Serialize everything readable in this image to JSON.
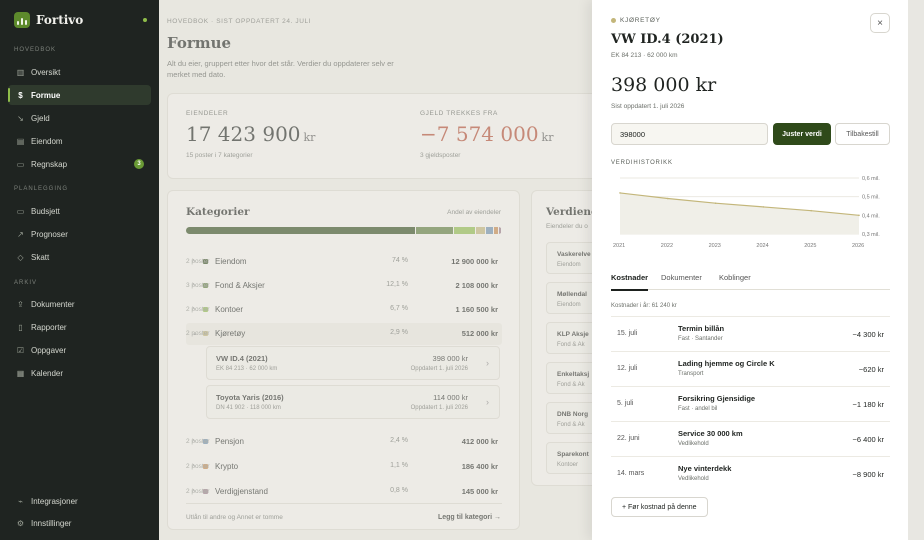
{
  "app": {
    "name": "Fortivo"
  },
  "sidebar": {
    "sections": {
      "main": "HOVEDBOK",
      "planning": "PLANLEGGING",
      "archive": "ARKIV"
    },
    "items": [
      {
        "label": "Oversikt",
        "icon": "bar-chart-icon"
      },
      {
        "label": "Formue",
        "icon": "dollar-icon",
        "active": true
      },
      {
        "label": "Gjeld",
        "icon": "trend-down-icon"
      },
      {
        "label": "Eiendom",
        "icon": "building-icon"
      },
      {
        "label": "Regnskap",
        "icon": "wallet-icon",
        "badge": "3"
      },
      {
        "label": "Budsjett",
        "icon": "card-icon"
      },
      {
        "label": "Prognoser",
        "icon": "trend-up-icon"
      },
      {
        "label": "Skatt",
        "icon": "shield-icon"
      },
      {
        "label": "Dokumenter",
        "icon": "upload-icon"
      },
      {
        "label": "Rapporter",
        "icon": "document-icon"
      },
      {
        "label": "Oppgaver",
        "icon": "checkbox-icon"
      },
      {
        "label": "Kalender",
        "icon": "calendar-icon"
      }
    ],
    "footer": [
      {
        "label": "Integrasjoner",
        "icon": "plug-icon"
      },
      {
        "label": "Innstillinger",
        "icon": "gear-icon"
      }
    ]
  },
  "main": {
    "breadcrumb": "HOVEDBOK · SIST OPPDATERT 24. JULI",
    "title": "Formue",
    "description": "Alt du eier, gruppert etter hvor det står. Verdier du oppdaterer selv er merket med dato.",
    "assets": {
      "label": "EIENDELER",
      "value": "17 423 900",
      "unit": "kr",
      "sub": "15 poster i 7 kategorier"
    },
    "debt": {
      "label": "GJELD TREKKES FRA",
      "value": "−7 574 000",
      "unit": "kr",
      "sub": "3 gjeldsposter"
    },
    "categories": {
      "title": "Kategorier",
      "share_label": "Andel av eiendeler",
      "rows": [
        {
          "name": "Eiendom",
          "count": "2 poster",
          "pct": "74 %",
          "amount": "12 900 000 kr",
          "color": "#2f4a1a",
          "chevron": "›"
        },
        {
          "name": "Fond & Aksjer",
          "count": "3 poster",
          "pct": "12,1 %",
          "amount": "2 108 000 kr",
          "color": "#5a7a3a",
          "chevron": "›"
        },
        {
          "name": "Kontoer",
          "count": "2 poster",
          "pct": "6,7 %",
          "amount": "1 160 500 kr",
          "color": "#8fbd4a",
          "chevron": "›"
        },
        {
          "name": "Kjøretøy",
          "count": "2 poster",
          "pct": "2,9 %",
          "amount": "512 000 kr",
          "color": "#c3b67a",
          "chevron": "⌄"
        },
        {
          "name": "Pensjon",
          "count": "2 poster",
          "pct": "2,4 %",
          "amount": "412 000 kr",
          "color": "#6c8fb0",
          "chevron": "›"
        },
        {
          "name": "Krypto",
          "count": "2 poster",
          "pct": "1,1 %",
          "amount": "186 400 kr",
          "color": "#c9884a",
          "chevron": "›"
        },
        {
          "name": "Verdigjenstand",
          "count": "2 poster",
          "pct": "0,8 %",
          "amount": "145 000 kr",
          "color": "#9a7a8a",
          "chevron": "›"
        }
      ],
      "vehicles": [
        {
          "title": "VW ID.4 (2021)",
          "sub": "EK 84 213 · 62 000 km",
          "amount": "398 000 kr",
          "date": "Oppdatert 1. juli 2026"
        },
        {
          "title": "Toyota Yaris (2016)",
          "sub": "DN 41 902 · 118 000 km",
          "amount": "114 000 kr",
          "date": "Oppdatert 1. juli 2026"
        }
      ],
      "footer_note": "Utlån til andre og Annet er tomme",
      "add_category": "Legg til kategori →"
    },
    "values_card": {
      "title": "Verdiene d",
      "sub": "Eiendeler du o",
      "items": [
        {
          "title": "Vaskerelve",
          "sub": "Eiendom"
        },
        {
          "title": "Møllendal",
          "sub": "Eiendom"
        },
        {
          "title": "KLP Aksje",
          "sub": "Fond & Ak"
        },
        {
          "title": "Enkeltaksj",
          "sub": "Fond & Ak"
        },
        {
          "title": "DNB Norg",
          "sub": "Fond & Ak"
        },
        {
          "title": "Sparekont",
          "sub": "Kontoer"
        }
      ]
    }
  },
  "drawer": {
    "kicker": "KJØRETØY",
    "title": "VW ID.4 (2021)",
    "sub": "EK 84 213 · 62 000 km",
    "value": "398 000 kr",
    "updated": "Sist oppdatert 1. juli 2026",
    "input_value": "398000",
    "adjust_label": "Juster verdi",
    "reset_label": "Tilbakestill",
    "history_label": "VERDIHISTORIKK",
    "tabs": [
      "Kostnader",
      "Dokumenter",
      "Koblinger"
    ],
    "cost_summary": "Kostnader i år: 61 240 kr",
    "costs": [
      {
        "date": "15. juli",
        "title": "Termin billån",
        "category": "Fast · Santander",
        "amount": "−4 300 kr"
      },
      {
        "date": "12. juli",
        "title": "Lading hjemme og Circle K",
        "category": "Transport",
        "amount": "−620 kr"
      },
      {
        "date": "5. juli",
        "title": "Forsikring Gjensidige",
        "category": "Fast · andel bil",
        "amount": "−1 180 kr"
      },
      {
        "date": "22. juni",
        "title": "Service 30 000 km",
        "category": "Vedlikehold",
        "amount": "−6 400 kr"
      },
      {
        "date": "14. mars",
        "title": "Nye vinterdekk",
        "category": "Vedlikehold",
        "amount": "−8 900 kr"
      }
    ],
    "add_cost_label": "+ Før kostnad på denne"
  },
  "chart_data": {
    "type": "area",
    "title": "VERDIHISTORIKK",
    "x": [
      2021,
      2022,
      2023,
      2024,
      2025,
      2026
    ],
    "series": [
      {
        "values": [
          0.52,
          0.49,
          0.465,
          0.445,
          0.425,
          0.4
        ]
      }
    ],
    "x_ticks": [
      "2021",
      "2022",
      "2023",
      "2024",
      "2025",
      "2026"
    ],
    "y_ticks": [
      "0,6 mil.",
      "0,5 mil.",
      "0,4 mil.",
      "0,3 mil."
    ],
    "y_tick_values": [
      0.6,
      0.5,
      0.4,
      0.3
    ],
    "ylim": [
      0.3,
      0.6
    ],
    "line_color": "#c3b67a"
  }
}
